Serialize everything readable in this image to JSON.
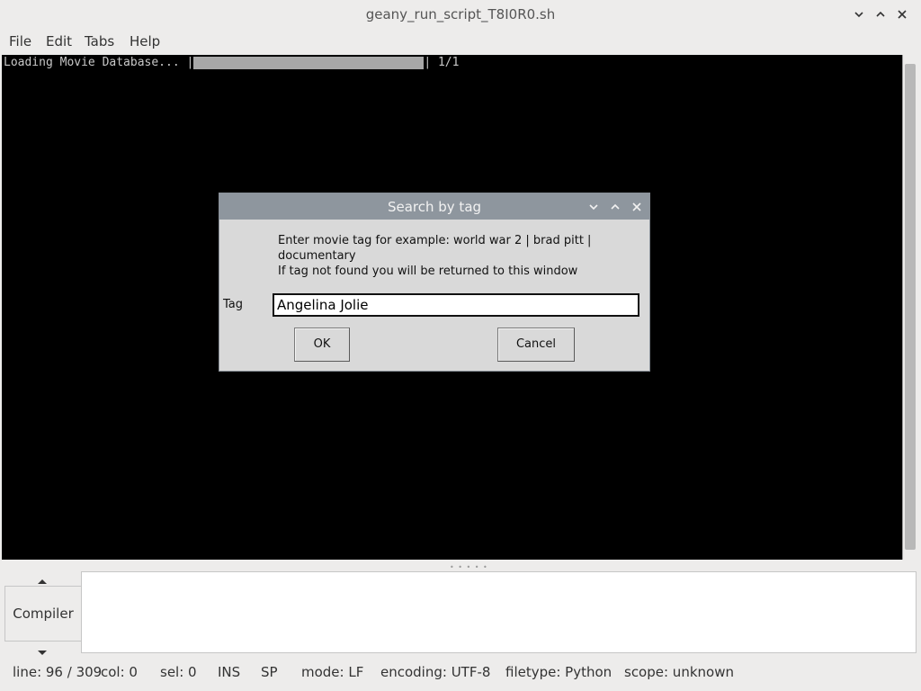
{
  "window": {
    "title": "geany_run_script_T8I0R0.sh"
  },
  "menu": {
    "file": "File",
    "edit": "Edit",
    "tabs": "Tabs",
    "help": "Help"
  },
  "terminal": {
    "text_before": "Loading Movie Database... |",
    "text_after": "| 1/1",
    "progress_fraction": 1.0
  },
  "dialog": {
    "title": "Search by tag",
    "message_line1": "Enter movie tag for example: world war 2 | brad pitt |",
    "message_line2": "documentary",
    "message_line3": "If tag not found you will be returned to this window",
    "tag_label": "Tag",
    "tag_value": "Angelina Jolie",
    "ok_label": "OK",
    "cancel_label": "Cancel"
  },
  "bottom_panel": {
    "tab_label": "Compiler"
  },
  "statusbar": {
    "line": "line: 96 / 309",
    "col": "col: 0",
    "sel": "sel: 0",
    "ins": "INS",
    "sp": "SP",
    "mode": "mode: LF",
    "encoding": "encoding: UTF-8",
    "filetype": "filetype: Python",
    "scope": "scope: unknown"
  },
  "colors": {
    "terminal_bg": "#000000",
    "dialog_titlebar": "#8e969e",
    "dialog_bg": "#d9d9d9",
    "window_bg": "#edeceb"
  }
}
